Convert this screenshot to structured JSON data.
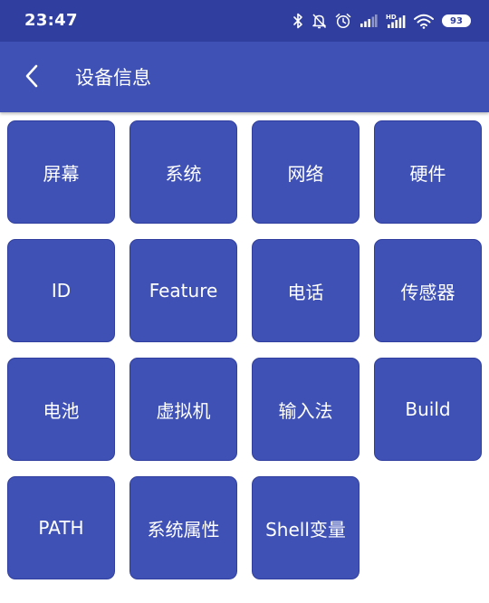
{
  "status_bar": {
    "time": "23:47",
    "battery": "93",
    "icons": [
      "bluetooth-icon",
      "mute-bell-icon",
      "alarm-icon",
      "signal-icon",
      "hd-signal-icon",
      "wifi-icon",
      "battery-icon"
    ]
  },
  "app_bar": {
    "title": "设备信息",
    "back_icon": "chevron-left-icon"
  },
  "colors": {
    "status_bar": "#303f9f",
    "primary": "#3f51b5",
    "tile_text": "#ffffff"
  },
  "tiles": [
    {
      "label": "屏幕"
    },
    {
      "label": "系统"
    },
    {
      "label": "网络"
    },
    {
      "label": "硬件"
    },
    {
      "label": "ID"
    },
    {
      "label": "Feature"
    },
    {
      "label": "电话"
    },
    {
      "label": "传感器"
    },
    {
      "label": "电池"
    },
    {
      "label": "虚拟机"
    },
    {
      "label": "输入法"
    },
    {
      "label": "Build"
    },
    {
      "label": "PATH"
    },
    {
      "label": "系统属性"
    },
    {
      "label": "Shell变量"
    }
  ]
}
